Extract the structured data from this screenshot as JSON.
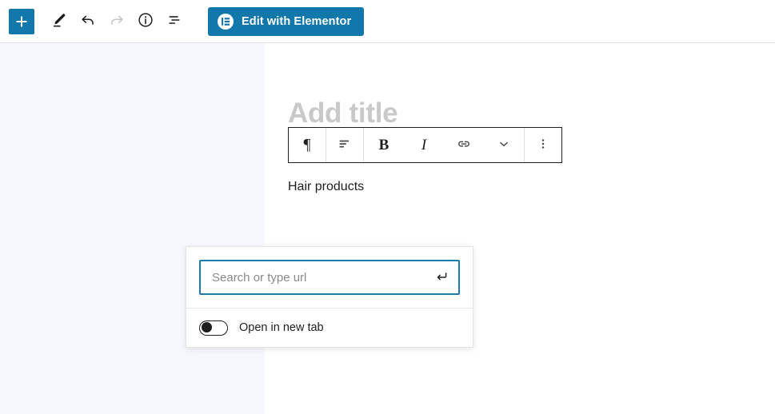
{
  "top_bar": {
    "add_block": {
      "icon": "plus-icon",
      "label": "Add block",
      "color": "#1278ab"
    },
    "tools": [
      {
        "name": "edit-pencil-icon",
        "label": "Tools"
      },
      {
        "name": "undo-icon",
        "label": "Undo"
      },
      {
        "name": "redo-icon",
        "label": "Redo",
        "disabled": true
      },
      {
        "name": "info-icon",
        "label": "Details"
      },
      {
        "name": "list-view-icon",
        "label": "List view"
      }
    ],
    "elementor": {
      "label": "Edit with Elementor",
      "icon": "elementor-logo-icon",
      "color": "#1278ab"
    }
  },
  "editor": {
    "title_placeholder": "Add title",
    "paragraph_text": "Hair products"
  },
  "block_toolbar": {
    "items": [
      {
        "name": "paragraph-block-type-icon",
        "glyph": "¶",
        "label": "Paragraph"
      },
      {
        "name": "align-text-icon",
        "glyph": "",
        "label": "Align text"
      },
      {
        "name": "bold-icon",
        "glyph": "B",
        "label": "Bold"
      },
      {
        "name": "italic-icon",
        "glyph": "I",
        "label": "Italic"
      },
      {
        "name": "link-icon",
        "glyph": "",
        "label": "Link"
      },
      {
        "name": "chevron-down-icon",
        "glyph": "",
        "label": "More rich text controls"
      },
      {
        "name": "more-options-icon",
        "glyph": "",
        "label": "Options"
      }
    ]
  },
  "link_popover": {
    "search": {
      "placeholder": "Search or type url",
      "value": "",
      "submit_icon": "enter-arrow-icon",
      "focus_color": "#1a7aad"
    },
    "new_tab": {
      "label": "Open in new tab",
      "state": "off"
    }
  }
}
